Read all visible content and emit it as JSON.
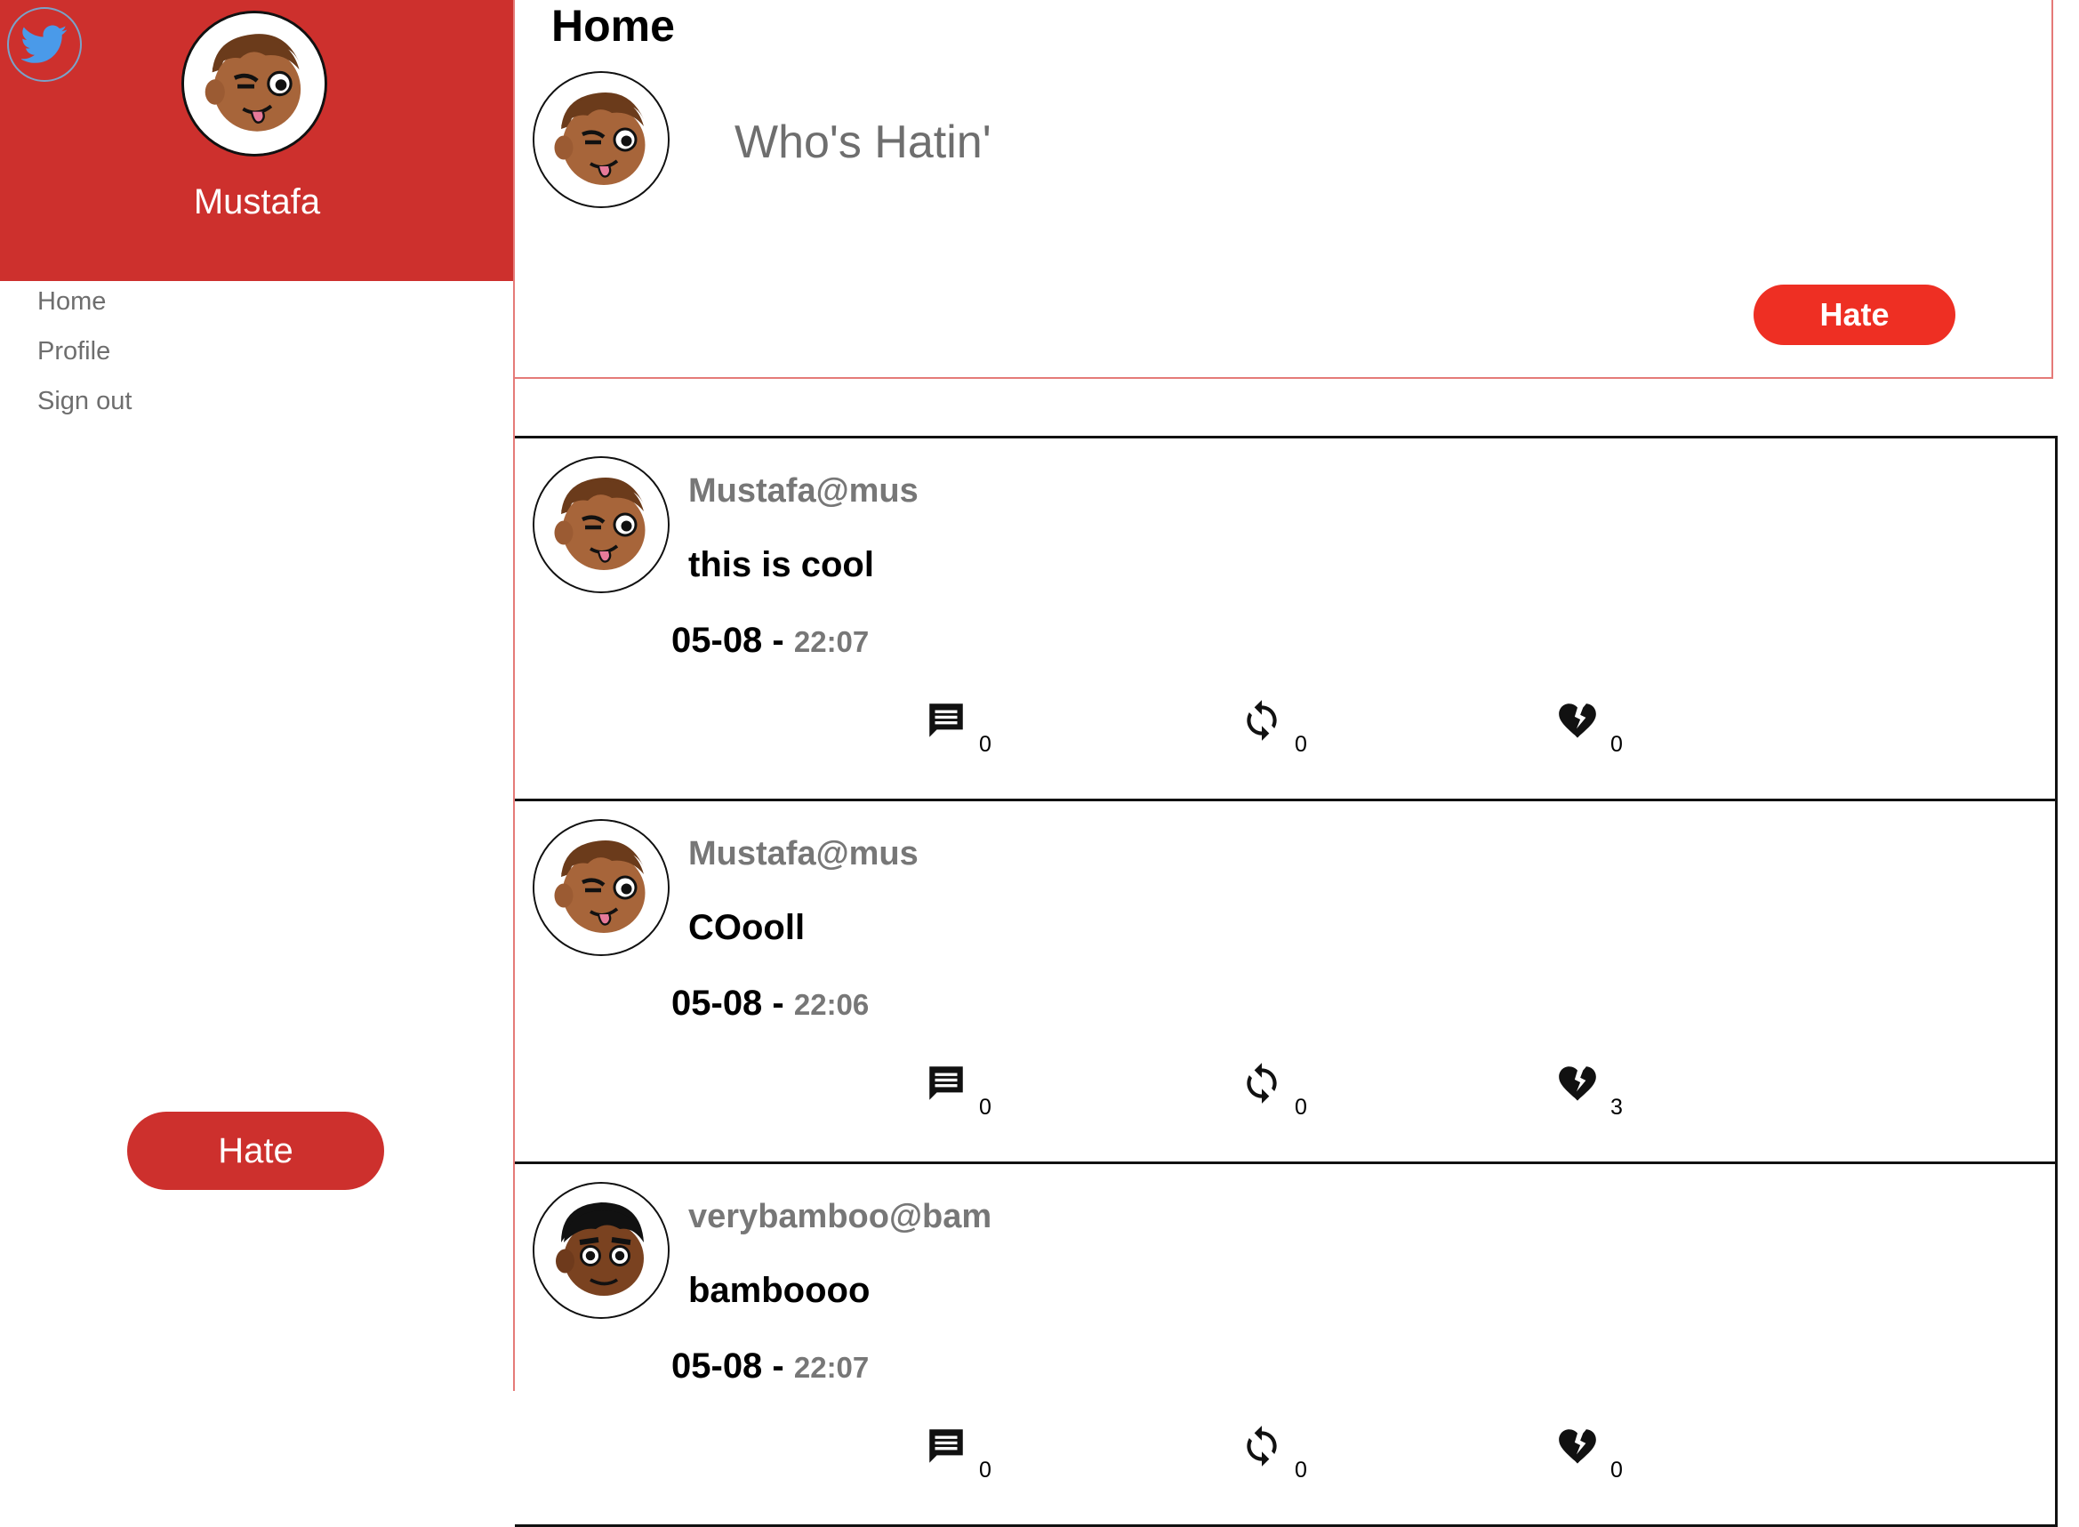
{
  "sidebar": {
    "user_name": "Mustafa",
    "nav": [
      "Home",
      "Profile",
      "Sign out"
    ],
    "hate_button": "Hate"
  },
  "main": {
    "title": "Home",
    "compose": {
      "placeholder": "Who's Hatin'",
      "button": "Hate"
    },
    "posts": [
      {
        "author": "Mustafa@mus",
        "text": "this is cool",
        "date": "05-08",
        "time": "22:07",
        "comments": "0",
        "rehates": "0",
        "hates": "0",
        "avatar": "winking-avatar"
      },
      {
        "author": "Mustafa@mus",
        "text": "COooll",
        "date": "05-08",
        "time": "22:06",
        "comments": "0",
        "rehates": "0",
        "hates": "3",
        "avatar": "winking-avatar"
      },
      {
        "author": "verybamboo@bam",
        "text": "bamboooo",
        "date": "05-08",
        "time": "22:07",
        "comments": "0",
        "rehates": "0",
        "hates": "0",
        "avatar": "surprised-avatar"
      }
    ]
  },
  "colors": {
    "brand_red": "#cd302d",
    "button_red": "#ee2f23",
    "muted_text": "#777777",
    "bird_blue": "#4a9ae9"
  }
}
